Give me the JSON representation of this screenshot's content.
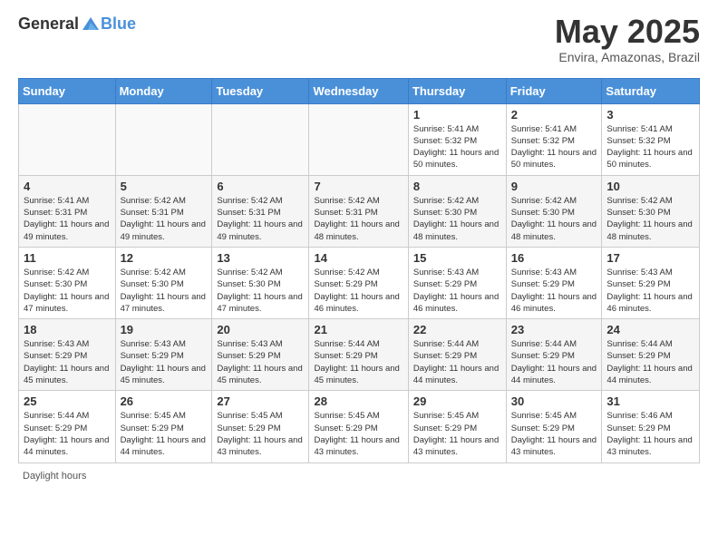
{
  "header": {
    "logo": {
      "text_general": "General",
      "text_blue": "Blue"
    },
    "title": "May 2025",
    "subtitle": "Envira, Amazonas, Brazil"
  },
  "calendar": {
    "days_of_week": [
      "Sunday",
      "Monday",
      "Tuesday",
      "Wednesday",
      "Thursday",
      "Friday",
      "Saturday"
    ],
    "weeks": [
      [
        {
          "day": "",
          "info": ""
        },
        {
          "day": "",
          "info": ""
        },
        {
          "day": "",
          "info": ""
        },
        {
          "day": "",
          "info": ""
        },
        {
          "day": "1",
          "info": "Sunrise: 5:41 AM\nSunset: 5:32 PM\nDaylight: 11 hours and 50 minutes."
        },
        {
          "day": "2",
          "info": "Sunrise: 5:41 AM\nSunset: 5:32 PM\nDaylight: 11 hours and 50 minutes."
        },
        {
          "day": "3",
          "info": "Sunrise: 5:41 AM\nSunset: 5:32 PM\nDaylight: 11 hours and 50 minutes."
        }
      ],
      [
        {
          "day": "4",
          "info": "Sunrise: 5:41 AM\nSunset: 5:31 PM\nDaylight: 11 hours and 49 minutes."
        },
        {
          "day": "5",
          "info": "Sunrise: 5:42 AM\nSunset: 5:31 PM\nDaylight: 11 hours and 49 minutes."
        },
        {
          "day": "6",
          "info": "Sunrise: 5:42 AM\nSunset: 5:31 PM\nDaylight: 11 hours and 49 minutes."
        },
        {
          "day": "7",
          "info": "Sunrise: 5:42 AM\nSunset: 5:31 PM\nDaylight: 11 hours and 48 minutes."
        },
        {
          "day": "8",
          "info": "Sunrise: 5:42 AM\nSunset: 5:30 PM\nDaylight: 11 hours and 48 minutes."
        },
        {
          "day": "9",
          "info": "Sunrise: 5:42 AM\nSunset: 5:30 PM\nDaylight: 11 hours and 48 minutes."
        },
        {
          "day": "10",
          "info": "Sunrise: 5:42 AM\nSunset: 5:30 PM\nDaylight: 11 hours and 48 minutes."
        }
      ],
      [
        {
          "day": "11",
          "info": "Sunrise: 5:42 AM\nSunset: 5:30 PM\nDaylight: 11 hours and 47 minutes."
        },
        {
          "day": "12",
          "info": "Sunrise: 5:42 AM\nSunset: 5:30 PM\nDaylight: 11 hours and 47 minutes."
        },
        {
          "day": "13",
          "info": "Sunrise: 5:42 AM\nSunset: 5:30 PM\nDaylight: 11 hours and 47 minutes."
        },
        {
          "day": "14",
          "info": "Sunrise: 5:42 AM\nSunset: 5:29 PM\nDaylight: 11 hours and 46 minutes."
        },
        {
          "day": "15",
          "info": "Sunrise: 5:43 AM\nSunset: 5:29 PM\nDaylight: 11 hours and 46 minutes."
        },
        {
          "day": "16",
          "info": "Sunrise: 5:43 AM\nSunset: 5:29 PM\nDaylight: 11 hours and 46 minutes."
        },
        {
          "day": "17",
          "info": "Sunrise: 5:43 AM\nSunset: 5:29 PM\nDaylight: 11 hours and 46 minutes."
        }
      ],
      [
        {
          "day": "18",
          "info": "Sunrise: 5:43 AM\nSunset: 5:29 PM\nDaylight: 11 hours and 45 minutes."
        },
        {
          "day": "19",
          "info": "Sunrise: 5:43 AM\nSunset: 5:29 PM\nDaylight: 11 hours and 45 minutes."
        },
        {
          "day": "20",
          "info": "Sunrise: 5:43 AM\nSunset: 5:29 PM\nDaylight: 11 hours and 45 minutes."
        },
        {
          "day": "21",
          "info": "Sunrise: 5:44 AM\nSunset: 5:29 PM\nDaylight: 11 hours and 45 minutes."
        },
        {
          "day": "22",
          "info": "Sunrise: 5:44 AM\nSunset: 5:29 PM\nDaylight: 11 hours and 44 minutes."
        },
        {
          "day": "23",
          "info": "Sunrise: 5:44 AM\nSunset: 5:29 PM\nDaylight: 11 hours and 44 minutes."
        },
        {
          "day": "24",
          "info": "Sunrise: 5:44 AM\nSunset: 5:29 PM\nDaylight: 11 hours and 44 minutes."
        }
      ],
      [
        {
          "day": "25",
          "info": "Sunrise: 5:44 AM\nSunset: 5:29 PM\nDaylight: 11 hours and 44 minutes."
        },
        {
          "day": "26",
          "info": "Sunrise: 5:45 AM\nSunset: 5:29 PM\nDaylight: 11 hours and 44 minutes."
        },
        {
          "day": "27",
          "info": "Sunrise: 5:45 AM\nSunset: 5:29 PM\nDaylight: 11 hours and 43 minutes."
        },
        {
          "day": "28",
          "info": "Sunrise: 5:45 AM\nSunset: 5:29 PM\nDaylight: 11 hours and 43 minutes."
        },
        {
          "day": "29",
          "info": "Sunrise: 5:45 AM\nSunset: 5:29 PM\nDaylight: 11 hours and 43 minutes."
        },
        {
          "day": "30",
          "info": "Sunrise: 5:45 AM\nSunset: 5:29 PM\nDaylight: 11 hours and 43 minutes."
        },
        {
          "day": "31",
          "info": "Sunrise: 5:46 AM\nSunset: 5:29 PM\nDaylight: 11 hours and 43 minutes."
        }
      ]
    ]
  },
  "footer": {
    "text": "Daylight hours"
  }
}
